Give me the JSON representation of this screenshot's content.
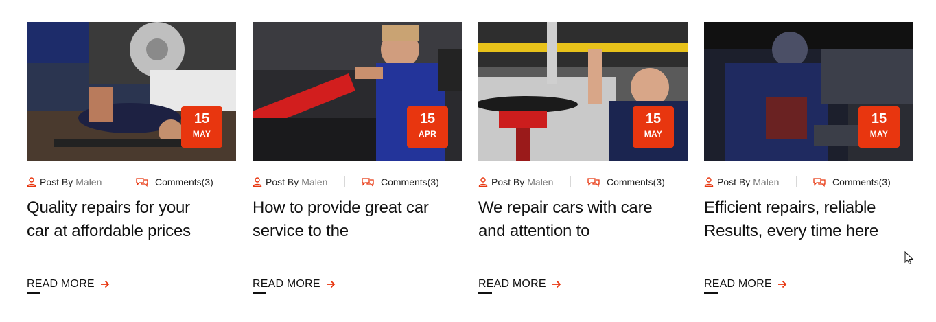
{
  "posts": [
    {
      "image": "mechanic-under-car-brake-photo",
      "day": "15",
      "month": "MAY",
      "post_label": "Post By",
      "author": "Malen",
      "comments": "Comments(3)",
      "title_line1": "Quality repairs for your",
      "title_line2": "car at affordable prices",
      "read_more": "READ MORE"
    },
    {
      "image": "mechanic-engine-bay-photo",
      "day": "15",
      "month": "APR",
      "post_label": "Post By",
      "author": "Malen",
      "comments": "Comments(3)",
      "title_line1": "How to provide great car",
      "title_line2": "service to the",
      "read_more": "READ MORE"
    },
    {
      "image": "mechanic-under-lift-photo",
      "day": "15",
      "month": "MAY",
      "post_label": "Post By",
      "author": "Malen",
      "comments": "Comments(3)",
      "title_line1": "We repair cars with care",
      "title_line2": "and attention to",
      "read_more": "READ MORE"
    },
    {
      "image": "mechanic-dark-garage-photo",
      "day": "15",
      "month": "MAY",
      "post_label": "Post By",
      "author": "Malen",
      "comments": "Comments(3)",
      "title_line1": "Efficient repairs, reliable",
      "title_line2": "Results, every time here",
      "read_more": "READ MORE"
    }
  ],
  "colors": {
    "accent": "#e8360f",
    "text": "#111111",
    "muted": "#777777"
  }
}
